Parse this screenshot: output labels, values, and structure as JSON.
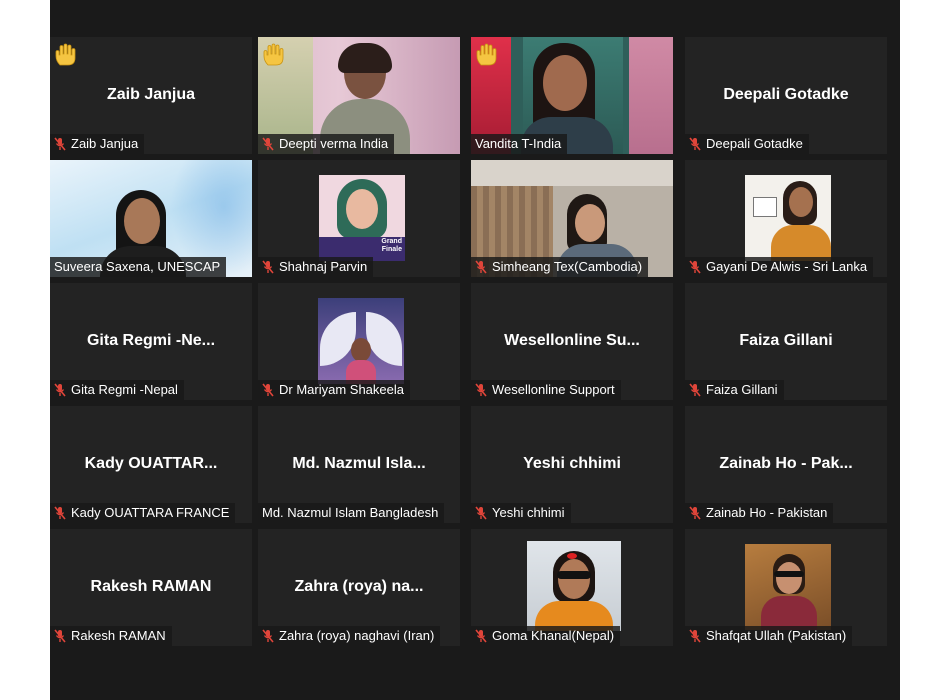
{
  "colors": {
    "background": "#1a1a1a",
    "tile": "#232323",
    "active_speaker_border": "#c8de5a",
    "muted_icon": "#e0453a",
    "hand": "#f5c542"
  },
  "participants": [
    {
      "name": "Zaib Janjua",
      "display": "Zaib Janjua",
      "muted": true,
      "hand_raised": true,
      "kind": "name"
    },
    {
      "name": "Deepti verma India",
      "display": "",
      "muted": true,
      "hand_raised": true,
      "kind": "video"
    },
    {
      "name": "Vandita T-India",
      "display": "",
      "muted": false,
      "hand_raised": true,
      "kind": "video",
      "active_speaker": true
    },
    {
      "name": "Deepali Gotadke",
      "display": "Deepali Gotadke",
      "muted": true,
      "hand_raised": false,
      "kind": "name"
    },
    {
      "name": "Suveera Saxena, UNESCAP",
      "display": "",
      "muted": false,
      "hand_raised": false,
      "kind": "video"
    },
    {
      "name": "Shahnaj Parvin",
      "display": "",
      "muted": true,
      "hand_raised": false,
      "kind": "photo"
    },
    {
      "name": "Simheang Tex(Cambodia)",
      "display": "",
      "muted": true,
      "hand_raised": false,
      "kind": "video"
    },
    {
      "name": "Gayani De Alwis - Sri Lanka",
      "display": "",
      "muted": true,
      "hand_raised": false,
      "kind": "photo"
    },
    {
      "name": "Gita Regmi -Nepal",
      "display": "Gita Regmi -Ne...",
      "muted": true,
      "hand_raised": false,
      "kind": "name"
    },
    {
      "name": "Dr Mariyam Shakeela",
      "display": "",
      "muted": true,
      "hand_raised": false,
      "kind": "photo"
    },
    {
      "name": "Wesellonline Support",
      "display": "Wesellonline  Su...",
      "muted": true,
      "hand_raised": false,
      "kind": "name"
    },
    {
      "name": "Faiza Gillani",
      "display": "Faiza Gillani",
      "muted": true,
      "hand_raised": false,
      "kind": "name"
    },
    {
      "name": "Kady OUATTARA FRANCE",
      "display": "Kady OUATTAR...",
      "muted": true,
      "hand_raised": false,
      "kind": "name"
    },
    {
      "name": "Md. Nazmul Islam Bangladesh",
      "display": "Md. Nazmul Isla...",
      "muted": false,
      "hand_raised": false,
      "kind": "name"
    },
    {
      "name": "Yeshi chhimi",
      "display": "Yeshi chhimi",
      "muted": true,
      "hand_raised": false,
      "kind": "name"
    },
    {
      "name": "Zainab Ho - Pakistan",
      "display": "Zainab Ho - Pak...",
      "muted": true,
      "hand_raised": false,
      "kind": "name"
    },
    {
      "name": "Rakesh RAMAN",
      "display": "Rakesh RAMAN",
      "muted": true,
      "hand_raised": false,
      "kind": "name"
    },
    {
      "name": "Zahra (roya) naghavi (Iran)",
      "display": "Zahra (roya) na...",
      "muted": true,
      "hand_raised": false,
      "kind": "name"
    },
    {
      "name": "Goma Khanal(Nepal)",
      "display": "",
      "muted": true,
      "hand_raised": false,
      "kind": "photo"
    },
    {
      "name": "Shafqat Ullah (Pakistan)",
      "display": "",
      "muted": true,
      "hand_raised": false,
      "kind": "photo"
    }
  ],
  "photo_texts": {
    "shahnaj_banner": "Grand Finale"
  }
}
